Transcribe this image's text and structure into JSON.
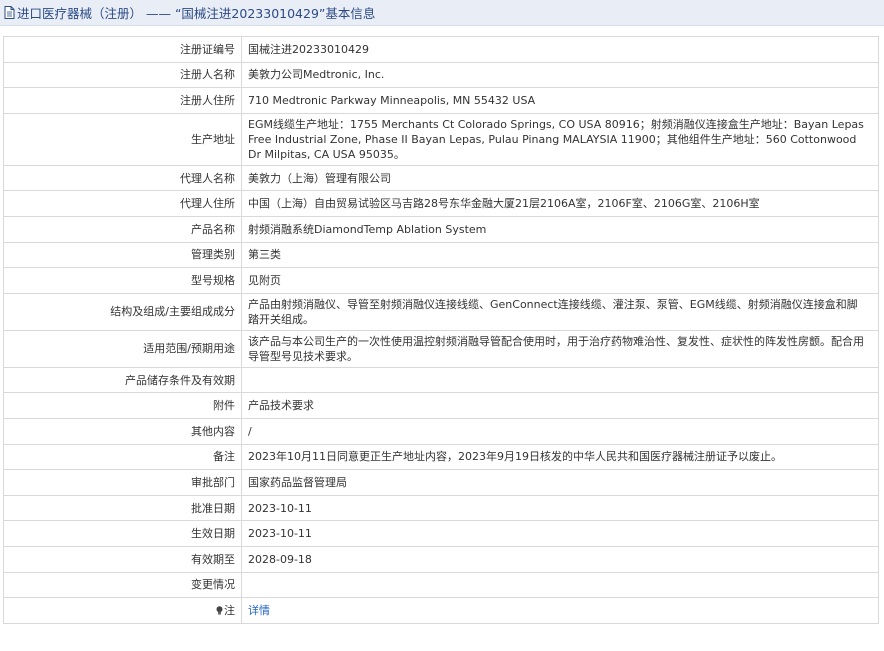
{
  "header": {
    "title": "进口医疗器械（注册） —— “国械注进20233010429”基本信息"
  },
  "rows": [
    {
      "key": "注册证编号",
      "value": "国械注进20233010429"
    },
    {
      "key": "注册人名称",
      "value": "美敦力公司Medtronic, Inc."
    },
    {
      "key": "注册人住所",
      "value": "710 Medtronic Parkway Minneapolis, MN 55432 USA"
    },
    {
      "key": "生产地址",
      "value": "EGM线缆生产地址：1755 Merchants Ct Colorado Springs, CO USA 80916；射频消融仪连接盒生产地址：Bayan Lepas Free Industrial Zone, Phase II Bayan Lepas, Pulau Pinang MALAYSIA 11900；其他组件生产地址：560 Cottonwood Dr Milpitas, CA USA 95035。"
    },
    {
      "key": "代理人名称",
      "value": "美敦力（上海）管理有限公司"
    },
    {
      "key": "代理人住所",
      "value": "中国（上海）自由贸易试验区马吉路28号东华金融大厦21层2106A室，2106F室、2106G室、2106H室"
    },
    {
      "key": "产品名称",
      "value": "射频消融系统DiamondTemp Ablation System"
    },
    {
      "key": "管理类别",
      "value": "第三类"
    },
    {
      "key": "型号规格",
      "value": "见附页"
    },
    {
      "key": "结构及组成/主要组成成分",
      "value": "产品由射频消融仪、导管至射频消融仪连接线缆、GenConnect连接线缆、灌注泵、泵管、EGM线缆、射频消融仪连接盒和脚踏开关组成。"
    },
    {
      "key": "适用范围/预期用途",
      "value": "该产品与本公司生产的一次性使用温控射频消融导管配合使用时，用于治疗药物难治性、复发性、症状性的阵发性房颤。配合用导管型号见技术要求。"
    },
    {
      "key": "产品储存条件及有效期",
      "value": ""
    },
    {
      "key": "附件",
      "value": "产品技术要求"
    },
    {
      "key": "其他内容",
      "value": "/"
    },
    {
      "key": "备注",
      "value": "2023年10月11日同意更正生产地址内容，2023年9月19日核发的中华人民共和国医疗器械注册证予以废止。"
    },
    {
      "key": "审批部门",
      "value": "国家药品监督管理局"
    },
    {
      "key": "批准日期",
      "value": "2023-10-11"
    },
    {
      "key": "生效日期",
      "value": "2023-10-11"
    },
    {
      "key": "有效期至",
      "value": "2028-09-18"
    },
    {
      "key": "变更情况",
      "value": ""
    }
  ],
  "note_row": {
    "key": "注",
    "link": "详情"
  }
}
